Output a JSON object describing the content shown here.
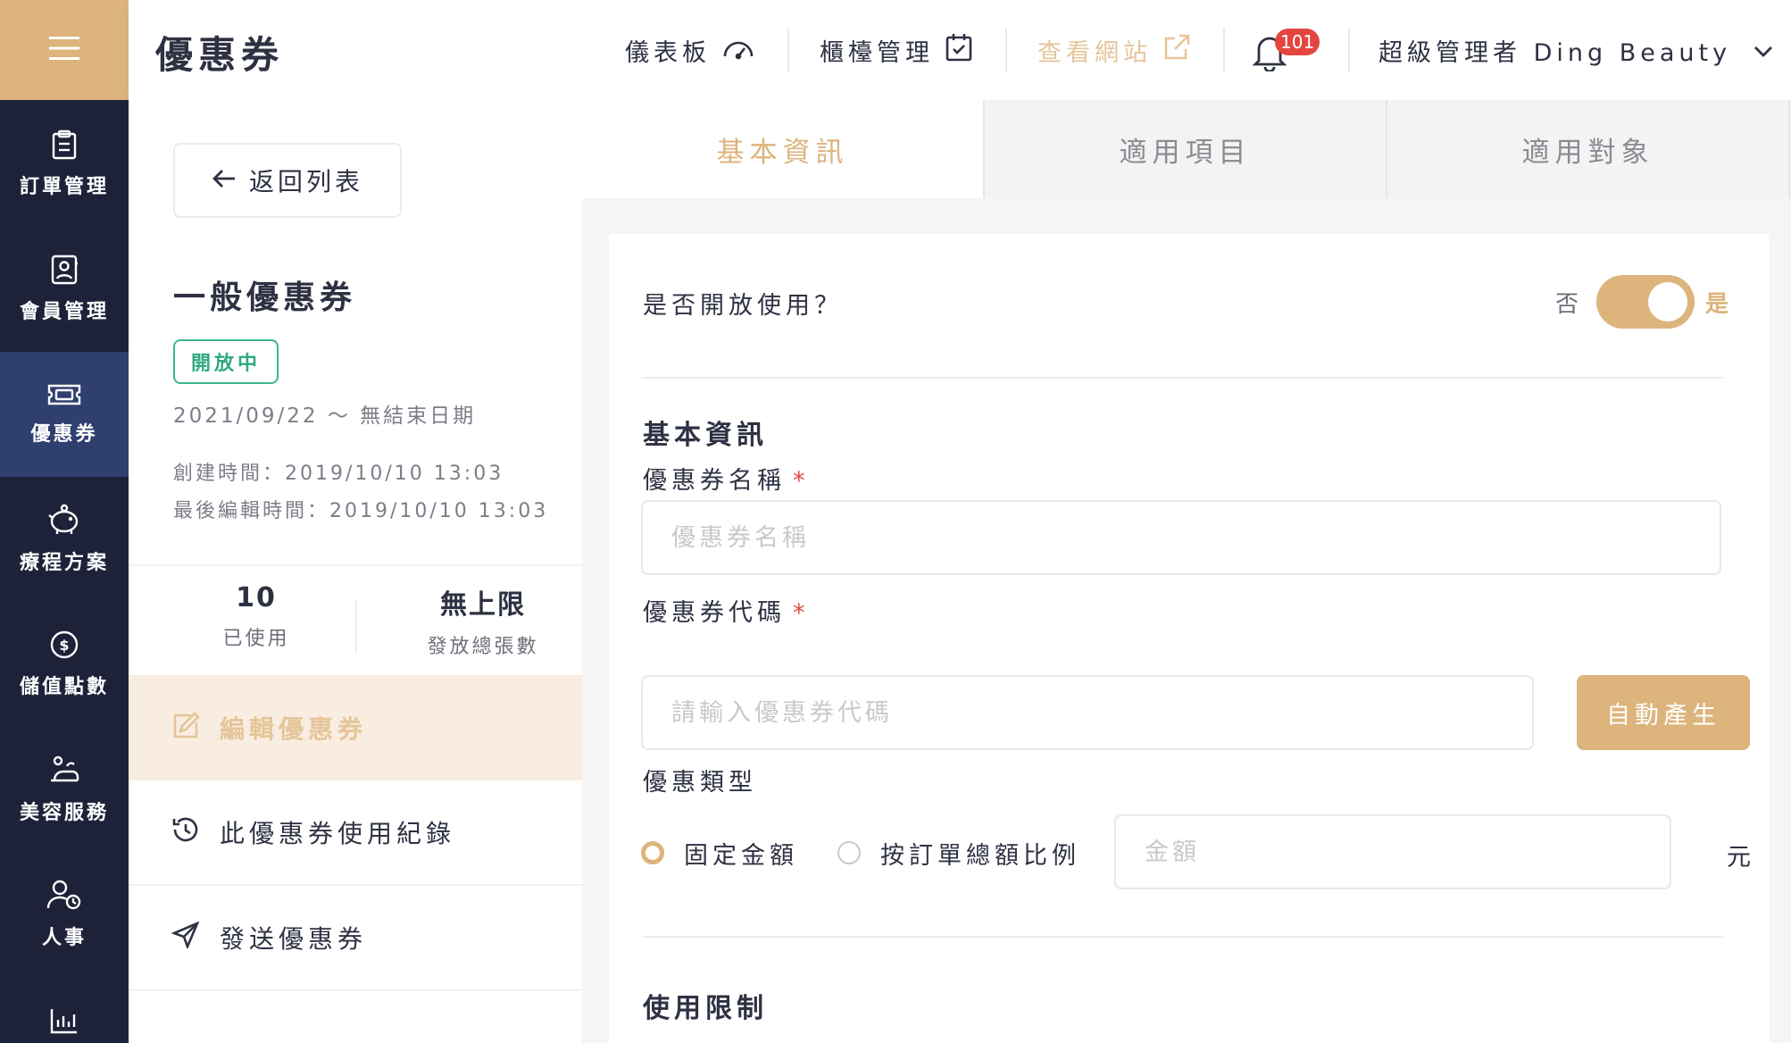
{
  "app": {
    "page_title": "優惠券"
  },
  "sidebar": {
    "items": [
      {
        "label": "訂單管理",
        "icon": "clipboard-icon",
        "active": false
      },
      {
        "label": "會員管理",
        "icon": "member-card-icon",
        "active": false
      },
      {
        "label": "優惠券",
        "icon": "ticket-icon",
        "active": true
      },
      {
        "label": "療程方案",
        "icon": "piggy-bank-icon",
        "active": false
      },
      {
        "label": "儲值點數",
        "icon": "dollar-coin-icon",
        "active": false
      },
      {
        "label": "美容服務",
        "icon": "spa-service-icon",
        "active": false
      },
      {
        "label": "人事",
        "icon": "staff-icon",
        "active": false
      }
    ],
    "partial_item_icon": "bar-chart-icon"
  },
  "header": {
    "dashboard": "儀表板",
    "counter": "櫃檯管理",
    "view_site": "查看網站",
    "notifications": "101",
    "user": "超級管理者 Ding Beauty"
  },
  "detail": {
    "back": "返回列表",
    "coupon_name": "一般優惠券",
    "status": "開放中",
    "date_range": "2021/09/22 ～ 無結束日期",
    "created": "創建時間：2019/10/10 13:03",
    "last_edited": "最後編輯時間：2019/10/10 13:03",
    "used_count": "10",
    "used_label": "已使用",
    "total_count": "無上限",
    "total_label": "發放總張數",
    "actions": [
      {
        "label": "編輯優惠券",
        "icon": "edit-icon",
        "active": true
      },
      {
        "label": "此優惠券使用紀錄",
        "icon": "history-icon",
        "active": false
      },
      {
        "label": "發送優惠券",
        "icon": "send-icon",
        "active": false
      }
    ]
  },
  "tabs": [
    {
      "label": "基本資訊",
      "active": true
    },
    {
      "label": "適用項目",
      "active": false
    },
    {
      "label": "適用對象",
      "active": false
    }
  ],
  "form": {
    "open_question": "是否開放使用？",
    "toggle_no": "否",
    "toggle_yes": "是",
    "toggle_on": true,
    "section_basic": "基本資訊",
    "name_label": "優惠券名稱",
    "name_placeholder": "優惠券名稱",
    "required_mark": "*",
    "code_label": "優惠券代碼",
    "code_placeholder": "請輸入優惠券代碼",
    "auto_generate": "自動產生",
    "type_label": "優惠類型",
    "type_options": [
      {
        "label": "固定金額",
        "checked": true
      },
      {
        "label": "按訂單總額比例",
        "checked": false
      }
    ],
    "amount_placeholder": "金額",
    "unit": "元",
    "section_limits": "使用限制"
  },
  "colors": {
    "accent": "#dcb47c",
    "sidebar_bg": "#1e2239",
    "sidebar_active": "#2f3f6e",
    "status_green": "#3bb98c",
    "danger": "#e2463e"
  }
}
